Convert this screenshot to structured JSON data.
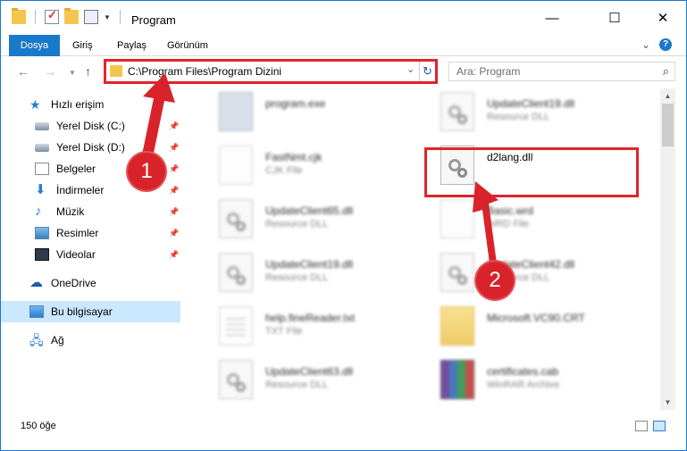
{
  "window": {
    "title": "Program"
  },
  "ribbon": {
    "tabs": [
      {
        "label": "Dosya"
      },
      {
        "label": "Giriş"
      },
      {
        "label": "Paylaş"
      },
      {
        "label": "Görünüm"
      }
    ]
  },
  "nav": {
    "address": "C:\\Program Files\\Program Dizini",
    "search_placeholder": "Ara: Program"
  },
  "sidebar": {
    "items": [
      {
        "label": "Hızlı erişim",
        "icon": "star-icon"
      },
      {
        "label": "Yerel Disk (C:)",
        "icon": "disk-icon"
      },
      {
        "label": "Yerel Disk (D:)",
        "icon": "disk-icon"
      },
      {
        "label": "Belgeler",
        "icon": "document-icon"
      },
      {
        "label": "İndirmeler",
        "icon": "download-icon"
      },
      {
        "label": "Müzik",
        "icon": "music-icon"
      },
      {
        "label": "Resimler",
        "icon": "pictures-icon"
      },
      {
        "label": "Videolar",
        "icon": "video-icon"
      },
      {
        "label": "OneDrive",
        "icon": "cloud-icon"
      },
      {
        "label": "Bu bilgisayar",
        "icon": "computer-icon"
      },
      {
        "label": "Ağ",
        "icon": "network-icon"
      }
    ]
  },
  "files": [
    {
      "name": "program.exe",
      "type": "",
      "icon": "exe-icon"
    },
    {
      "name": "UpdateClient19.dll",
      "type": "Resource DLL",
      "icon": "dll-icon"
    },
    {
      "name": "FastNmt.cjk",
      "type": "CJK File",
      "icon": "file-icon"
    },
    {
      "name": "d2lang.dll",
      "type": "",
      "icon": "dll-icon"
    },
    {
      "name": "UpdateClient65.dll",
      "type": "Resource DLL",
      "icon": "dll-icon"
    },
    {
      "name": "Basic.wrd",
      "type": "WRD File",
      "icon": "file-icon"
    },
    {
      "name": "UpdateClient19.dll",
      "type": "Resource DLL",
      "icon": "dll-icon"
    },
    {
      "name": "UpdateClient42.dll",
      "type": "Resource DLL",
      "icon": "dll-icon"
    },
    {
      "name": "help.fineReader.txt",
      "type": "TXT File",
      "icon": "text-icon"
    },
    {
      "name": "Microsoft.VC90.CRT",
      "type": "",
      "icon": "folder-icon"
    },
    {
      "name": "UpdateClient63.dll",
      "type": "Resource DLL",
      "icon": "dll-icon"
    },
    {
      "name": "certificates.cab",
      "type": "WinRAR Archive",
      "icon": "winrar-icon"
    }
  ],
  "status": {
    "count": "150 öğe"
  },
  "annotations": {
    "marker1": "1",
    "marker2": "2"
  },
  "colors": {
    "accent": "#1979ca",
    "highlight": "#e0242c"
  }
}
